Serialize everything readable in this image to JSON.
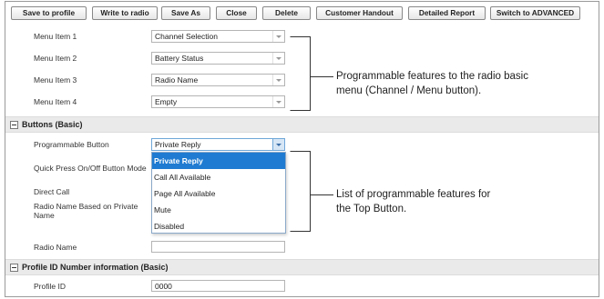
{
  "toolbar": {
    "save_to_profile": "Save to profile",
    "write_to_radio": "Write to radio",
    "save_as": "Save As",
    "close": "Close",
    "delete": "Delete",
    "customer_handout": "Customer Handout",
    "detailed_report": "Detailed Report",
    "switch_advanced": "Switch to ADVANCED"
  },
  "menu_items": [
    {
      "label": "Menu Item 1",
      "value": "Channel Selection"
    },
    {
      "label": "Menu Item 2",
      "value": "Battery Status"
    },
    {
      "label": "Menu Item 3",
      "value": "Radio Name"
    },
    {
      "label": "Menu Item 4",
      "value": "Empty"
    }
  ],
  "buttons_section": {
    "title": "Buttons (Basic)",
    "programmable_button_label": "Programmable Button",
    "programmable_button_value": "Private Reply",
    "quick_press_label": "Quick Press On/Off Button Mode",
    "direct_call_label": "Direct Call",
    "radio_name_private_label": "Radio Name Based on Private Name",
    "radio_name_label": "Radio Name",
    "radio_name_value": "",
    "dropdown_options": [
      "Private Reply",
      "Call All Available",
      "Page All Available",
      "Mute",
      "Disabled"
    ],
    "dropdown_selected_index": 0
  },
  "profile_section": {
    "title": "Profile ID Number information (Basic)",
    "profile_id_label": "Profile ID",
    "profile_id_value": "0000"
  },
  "annotations": {
    "menu_note_line1": "Programmable features to the radio basic",
    "menu_note_line2": "menu (Channel / Menu button).",
    "button_note_line1": "List of programmable features for",
    "button_note_line2": "the Top Button."
  },
  "colors": {
    "selected_option": "#1f7bd1",
    "section_header": "#eaeaea",
    "active_border": "#6fa7d9"
  }
}
